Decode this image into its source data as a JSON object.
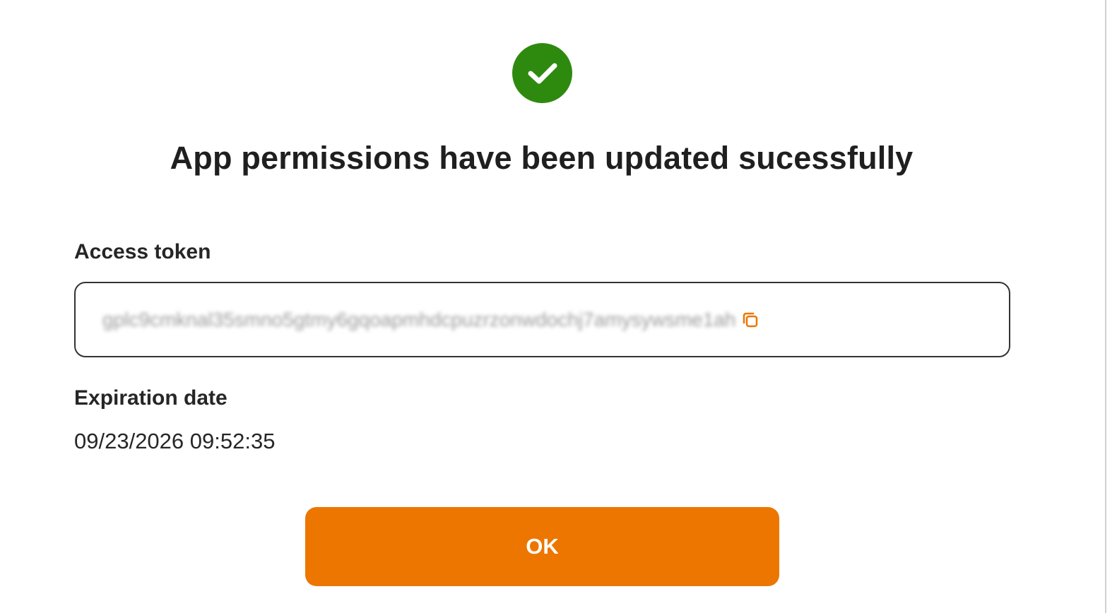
{
  "dialog": {
    "title": "App permissions have been updated sucessfully",
    "status_icon": "check-circle-icon",
    "accent_color": "#ec7600",
    "success_color": "#2e8a0f"
  },
  "access_token": {
    "label": "Access token",
    "value": "gplc9cmknal35smno5gtmy6gqoapmhdcpuzrzonwdochj7amysywsme1ah",
    "copy_icon": "copy-icon"
  },
  "expiration": {
    "label": "Expiration date",
    "value": "09/23/2026 09:52:35"
  },
  "actions": {
    "ok_label": "OK"
  }
}
